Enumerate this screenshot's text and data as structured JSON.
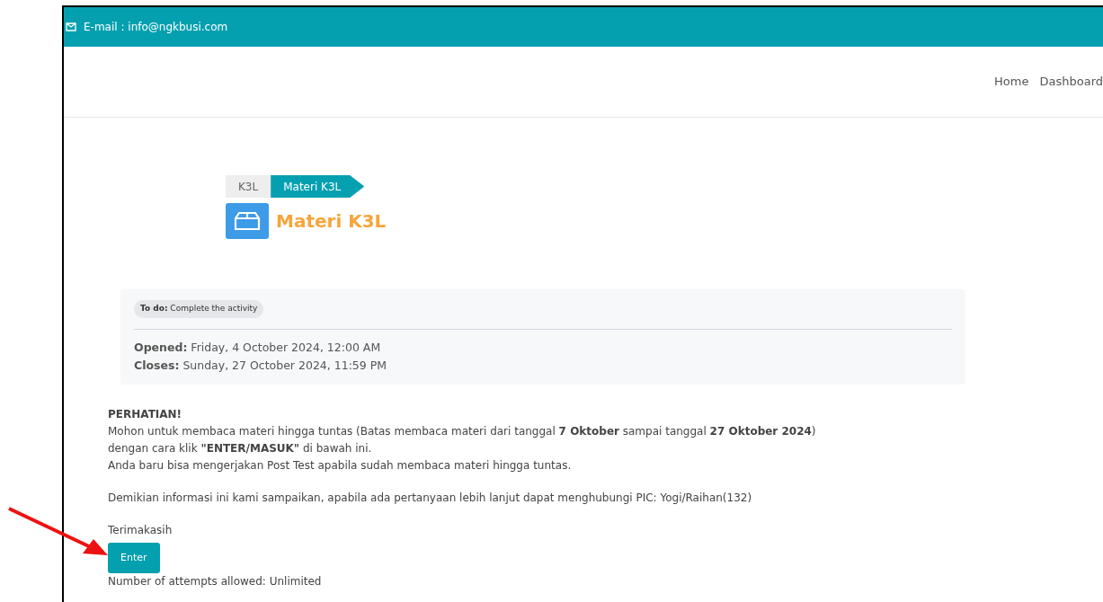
{
  "topbar": {
    "email": "E-mail : info@ngkbusi.com"
  },
  "nav": {
    "items": [
      "Home",
      "Dashboard"
    ]
  },
  "breadcrumb": [
    {
      "label": "K3L",
      "selected": false
    },
    {
      "label": "Materi K3L",
      "selected": true
    }
  ],
  "activity": {
    "title": "Materi K3L"
  },
  "todo": "**To do:** Complete the activity",
  "dates": [
    "**Opened:** Friday, 4 October 2024, 12:00 AM",
    "**Closes:** Sunday, 27 October 2024, 11:59 PM"
  ],
  "notice": {
    "heading": "PERHATIAN!",
    "lines": [
      "Mohon untuk membaca materi hingga tuntas (Batas membaca materi dari tanggal **7 Oktober** sampai tanggal **27 Oktober 2024**) dengan cara klik **\"ENTER/MASUK\"** di bawah ini.",
      "Anda baru bisa mengerjakan Post Test apabila sudah membaca materi hingga tuntas."
    ],
    "contact": "Demikian informasi ini kami sampaikan, apabila ada pertanyaan lebih lanjut dapat menghubungi PIC: Yogi/Raihan(132)",
    "thanks": "Terimakasih"
  },
  "button": "Enter",
  "attempts": "Number of attempts allowed: Unlimited"
}
